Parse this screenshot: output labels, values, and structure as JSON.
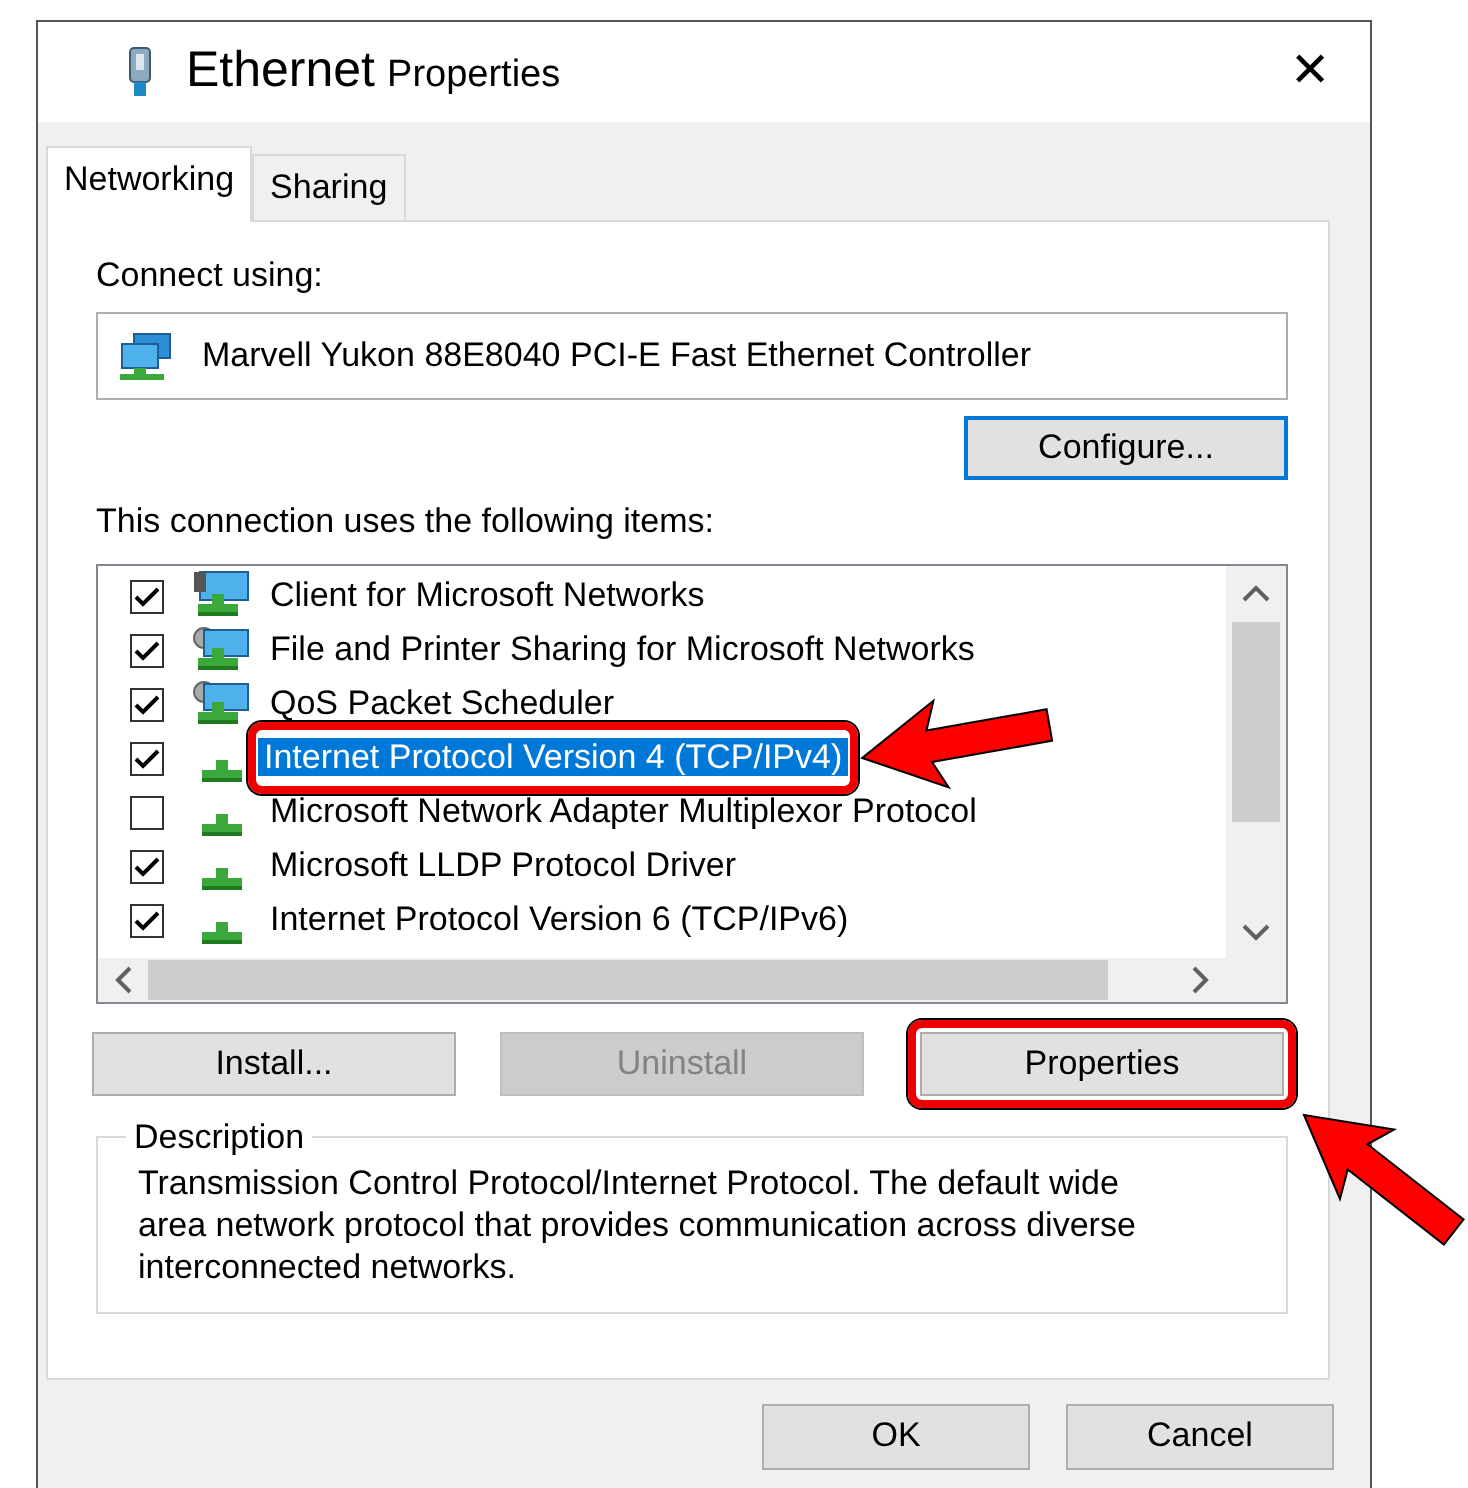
{
  "window": {
    "title_main": "Ethernet",
    "title_sub": "Properties",
    "close": "✕"
  },
  "tabs": [
    {
      "label": "Networking",
      "selected": true
    },
    {
      "label": "Sharing",
      "selected": false
    }
  ],
  "connect_using": {
    "label": "Connect using:",
    "adapter": "Marvell Yukon 88E8040 PCI-E Fast Ethernet Controller",
    "configure": "Configure..."
  },
  "items_label": "This connection uses the following items:",
  "items": [
    {
      "label": "Client for Microsoft Networks",
      "kind": "client",
      "checked": true,
      "selected": false,
      "highlighted": false
    },
    {
      "label": "File and Printer Sharing for Microsoft Networks",
      "kind": "service",
      "checked": true,
      "selected": false,
      "highlighted": false
    },
    {
      "label": "QoS Packet Scheduler",
      "kind": "service",
      "checked": true,
      "selected": false,
      "highlighted": false
    },
    {
      "label": "Internet Protocol Version 4 (TCP/IPv4)",
      "kind": "protocol",
      "checked": true,
      "selected": true,
      "highlighted": true
    },
    {
      "label": "Microsoft Network Adapter Multiplexor Protocol",
      "kind": "protocol",
      "checked": false,
      "selected": false,
      "highlighted": false
    },
    {
      "label": "Microsoft LLDP Protocol Driver",
      "kind": "protocol",
      "checked": true,
      "selected": false,
      "highlighted": false
    },
    {
      "label": "Internet Protocol Version 6 (TCP/IPv6)",
      "kind": "protocol",
      "checked": true,
      "selected": false,
      "highlighted": false
    }
  ],
  "item_buttons": [
    {
      "label": "Install...",
      "disabled": false,
      "highlighted": false
    },
    {
      "label": "Uninstall",
      "disabled": true,
      "highlighted": false
    },
    {
      "label": "Properties",
      "disabled": false,
      "highlighted": true
    }
  ],
  "description": {
    "legend": "Description",
    "text": "Transmission Control Protocol/Internet Protocol. The default wide area network protocol that provides communication across diverse interconnected networks."
  },
  "dialog_buttons": [
    {
      "label": "OK"
    },
    {
      "label": "Cancel"
    }
  ]
}
